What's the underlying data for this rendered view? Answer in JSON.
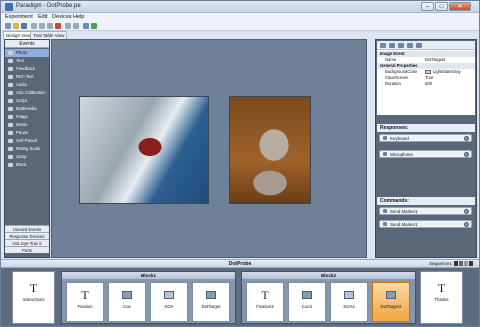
{
  "window": {
    "title": "Paradigm - DotProbe.pe",
    "controls": [
      "–",
      "□",
      "✕"
    ]
  },
  "menu": [
    "Experiment",
    "Edit",
    "Devices",
    "Help"
  ],
  "tabs": [
    {
      "label": "Design View",
      "active": true
    },
    {
      "label": "Trial Table View",
      "active": false
    }
  ],
  "events_panel": {
    "header": "Events",
    "items": [
      "Photo",
      "Text",
      "Feedback",
      "Rich Text",
      "Audio",
      "ASL Calibration",
      "Script",
      "Multimedia",
      "Image",
      "Movie",
      "Pause",
      "Self-Paced",
      "Rating Scale",
      "Jump",
      "Block"
    ],
    "selected": "Photo",
    "footer": [
      "Unused Events",
      "Response Devices",
      "ASL Eye-Trac 6",
      "Ports"
    ]
  },
  "properties": {
    "rows": [
      {
        "type": "cat",
        "key": "Image Event",
        "value": ""
      },
      {
        "type": "row",
        "key": "Name",
        "value": "DotTarget2"
      },
      {
        "type": "cat",
        "key": "General Properties",
        "value": ""
      },
      {
        "type": "row",
        "key": "BackgroundColor",
        "value": "LightSlateGray",
        "swatch": "#d3d3d3"
      },
      {
        "type": "row",
        "key": "ClearScreen",
        "value": "True"
      },
      {
        "type": "row",
        "key": "Duration",
        "value": "500"
      }
    ]
  },
  "responses": {
    "header": "Responses:",
    "items": [
      "Keyboard",
      "Microphone"
    ]
  },
  "commands": {
    "header": "Commands:",
    "items": [
      "Send Marker1",
      "Send Marker1"
    ]
  },
  "timeline": {
    "title": "DotProbe",
    "sequence_label": "Sequence1",
    "start": "Instructions",
    "end": "Thanks",
    "blocks": [
      {
        "label": "Block1",
        "events": [
          "Fixation",
          "Cue",
          "SOA",
          "DotTarget"
        ]
      },
      {
        "label": "Block2",
        "events": [
          "Fixation2",
          "Cue2",
          "SOA2",
          "DotTarget2"
        ]
      }
    ],
    "selected_event": "DotTarget2"
  },
  "colors": {
    "accent": "#f3a640",
    "panel": "#5a6779",
    "canvas": "#6e8196"
  }
}
